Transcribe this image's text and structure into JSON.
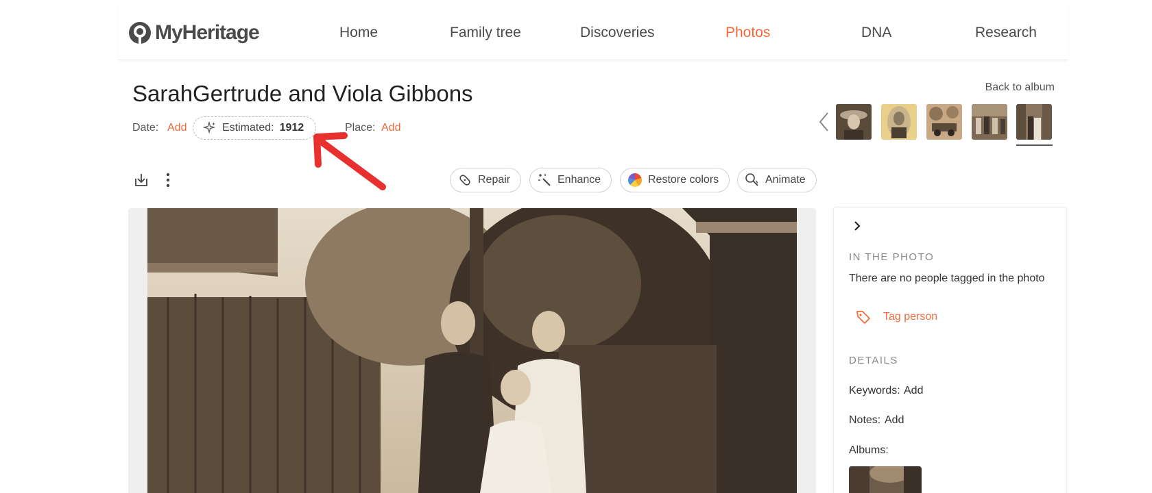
{
  "brand": {
    "name": "MyHeritage",
    "accent_color": "#f26a3b"
  },
  "nav": {
    "items": [
      {
        "label": "Home"
      },
      {
        "label": "Family tree"
      },
      {
        "label": "Discoveries"
      },
      {
        "label": "Photos",
        "active": true
      },
      {
        "label": "DNA"
      },
      {
        "label": "Research"
      }
    ]
  },
  "photo_page": {
    "title": "SarahGertrude and Viola Gibbons",
    "date_label": "Date:",
    "date_add": "Add",
    "estimated_label": "Estimated:",
    "estimated_value": "1912",
    "place_label": "Place:",
    "place_add": "Add",
    "back_to_album": "Back to album"
  },
  "thumbnails": [
    {
      "icon": "portrait-woman-hat-thumbnail"
    },
    {
      "icon": "portrait-man-oval-thumbnail"
    },
    {
      "icon": "vintage-car-thumbnail"
    },
    {
      "icon": "group-photo-thumbnail"
    },
    {
      "icon": "current-photo-thumbnail",
      "selected": true
    }
  ],
  "toolbar": {
    "download_icon": "download-icon",
    "more_icon": "more-vertical-icon",
    "buttons": [
      {
        "label": "Repair",
        "icon": "repair-icon"
      },
      {
        "label": "Enhance",
        "icon": "magic-wand-icon"
      },
      {
        "label": "Restore colors",
        "icon": "color-wheel-icon"
      },
      {
        "label": "Animate",
        "icon": "animate-icon"
      }
    ]
  },
  "side_panel": {
    "in_photo_heading": "IN THE PHOTO",
    "no_people_text": "There are no people tagged in the photo",
    "tag_person": "Tag person",
    "details_heading": "DETAILS",
    "keywords_label": "Keywords:",
    "keywords_add": "Add",
    "notes_label": "Notes:",
    "notes_add": "Add",
    "albums_label": "Albums:"
  }
}
